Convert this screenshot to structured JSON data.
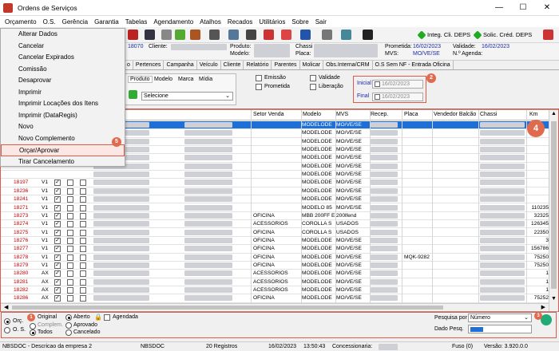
{
  "window": {
    "title": "Ordens de Serviços"
  },
  "menubar": [
    "Orçamento",
    "O.S.",
    "Gerência",
    "Garantia",
    "Tabelas",
    "Agendamento",
    "Atalhos",
    "Recados",
    "Utilitários",
    "Sobre",
    "Sair"
  ],
  "toolbar": {
    "integ": "Integ. Cli. DEPS",
    "solic": "Solic. Créd. DEPS"
  },
  "dropdown": [
    "Alterar Dados",
    "Cancelar",
    "Cancelar Expirados",
    "Comissão",
    "Desaprovar",
    "Imprimir",
    "Imprimir Locações dos Itens",
    "Imprimir (DataRegis)",
    "Novo",
    "Novo Complemento",
    "Orçar/Aprovar",
    "Tirar Cancelamento"
  ],
  "info": {
    "num": "18070",
    "cliente_lbl": "Cliente:",
    "produto_lbl": "Produto:",
    "modelo_lbl": "Modelo:",
    "chassi_lbl": "Chassi",
    "placa_lbl": "Placa:",
    "prometida_lbl": "Prometida:",
    "prometida": "16/02/2023",
    "mvs_lbl": "MVS:",
    "mvs": "MO/VE/SE",
    "validade_lbl": "Validade:",
    "validade": "16/02/2023",
    "agenda_lbl": "N.º Agenda:"
  },
  "tabs": [
    "o",
    "Pertences",
    "Campanha",
    "Veículo",
    "Cliente",
    "Relatório",
    "Parentes",
    "Molicar",
    "Obs.Interna/CRM",
    "O.S Sem NF - Entrada Oficina"
  ],
  "filter": {
    "subtabs": [
      "Produto",
      "Modelo",
      "Marca",
      "Mídia"
    ],
    "select": "Selecione",
    "checks": [
      "Emissão",
      "Prometida",
      "Validade",
      "Liberação"
    ],
    "inicial_lbl": "Inicial",
    "final_lbl": "Final",
    "inicial": "16/02/2023",
    "final": "16/02/2023"
  },
  "grid": {
    "headers": [
      "Setor Venda",
      "Modelo",
      "MVS",
      "Recep.",
      "Placa",
      "Vendedor Balcão",
      "Chassi",
      "Km"
    ],
    "rows": [
      {
        "code": "",
        "t": "",
        "setor": "",
        "modelo": "MODELODE",
        "mvs": "MO/VE/SE",
        "placa": "",
        "km": ""
      },
      {
        "code": "",
        "t": "",
        "setor": "",
        "modelo": "MODELODE",
        "mvs": "MO/VE/SE",
        "placa": "",
        "km": ""
      },
      {
        "code": "",
        "t": "",
        "setor": "",
        "modelo": "MODELODE",
        "mvs": "MO/VE/SE",
        "placa": "",
        "km": ""
      },
      {
        "code": "",
        "t": "",
        "setor": "",
        "modelo": "MODELODE",
        "mvs": "MO/VE/SE",
        "placa": "",
        "km": ""
      },
      {
        "code": "",
        "t": "",
        "setor": "",
        "modelo": "MODELODE",
        "mvs": "MO/VE/SE",
        "placa": "",
        "km": ""
      },
      {
        "code": "",
        "t": "",
        "setor": "",
        "modelo": "MODELODE",
        "mvs": "MO/VE/SE",
        "placa": "",
        "km": ""
      },
      {
        "code": "",
        "t": "",
        "setor": "",
        "modelo": "MODELODE",
        "mvs": "MO/VE/SE",
        "placa": "",
        "km": ""
      },
      {
        "code": "18197",
        "t": "V1",
        "setor": "",
        "modelo": "MODELODE",
        "mvs": "MO/VE/SE",
        "placa": "",
        "km": ""
      },
      {
        "code": "18236",
        "t": "V1",
        "setor": "",
        "modelo": "MODELODE",
        "mvs": "MO/VE/SE",
        "placa": "",
        "km": ""
      },
      {
        "code": "18241",
        "t": "V1",
        "setor": "",
        "modelo": "MODELODE",
        "mvs": "MO/VE/SE",
        "placa": "",
        "km": ""
      },
      {
        "code": "18271",
        "t": "V1",
        "setor": "",
        "modelo": "MODELO 85",
        "mvs": "MO/VE/SE",
        "placa": "",
        "km": "110235"
      },
      {
        "code": "18273",
        "t": "V1",
        "setor": "OFICINA",
        "modelo": "MBB 200FF E",
        "mvs": "200lfend",
        "placa": "",
        "km": "32325"
      },
      {
        "code": "18274",
        "t": "V1",
        "setor": "ACESSORIOS",
        "modelo": "COROLLA S",
        "mvs": "USADOS",
        "placa": "",
        "km": "126345"
      },
      {
        "code": "18275",
        "t": "V1",
        "setor": "OFICINA",
        "modelo": "COROLLA S",
        "mvs": "USADOS",
        "placa": "",
        "km": "22350"
      },
      {
        "code": "18276",
        "t": "V1",
        "setor": "OFICINA",
        "modelo": "MODELODE",
        "mvs": "MO/VE/SE",
        "placa": "",
        "km": "3"
      },
      {
        "code": "18277",
        "t": "V1",
        "setor": "OFICINA",
        "modelo": "MODELODE",
        "mvs": "MO/VE/SE",
        "placa": "",
        "km": "156786"
      },
      {
        "code": "18278",
        "t": "V1",
        "setor": "OFICINA",
        "modelo": "MODELODE",
        "mvs": "MO/VE/SE",
        "placa": "MQK-9282",
        "km": "75250"
      },
      {
        "code": "18279",
        "t": "V1",
        "setor": "OFICINA",
        "modelo": "MODELODE",
        "mvs": "MO/VE/SE",
        "placa": "",
        "km": "75250"
      },
      {
        "code": "18280",
        "t": "AX",
        "setor": "ACESSORIOS",
        "modelo": "MODELODE",
        "mvs": "MO/VE/SE",
        "placa": "",
        "km": "1"
      },
      {
        "code": "18281",
        "t": "AX",
        "setor": "ACESSORIOS",
        "modelo": "MODELODE",
        "mvs": "MO/VE/SE",
        "placa": "",
        "km": "1"
      },
      {
        "code": "18282",
        "t": "AX",
        "setor": "ACESSORIOS",
        "modelo": "MODELODE",
        "mvs": "MO/VE/SE",
        "placa": "",
        "km": "1"
      },
      {
        "code": "18286",
        "t": "AX",
        "setor": "OFICINA",
        "modelo": "MODELODE",
        "mvs": "MO/VE/SE",
        "placa": "",
        "km": "75252"
      }
    ]
  },
  "bottom": {
    "orc": "Orç.",
    "os": "O. S.",
    "original": "Original",
    "complem": "Complem.",
    "todos": "Todos",
    "aberto": "Aberto",
    "aprovado": "Aprovado",
    "cancelado": "Cancelado",
    "agendada": "Agendada",
    "pesquisa_lbl": "Pesquisa por",
    "pesquisa_val": "Número",
    "dado_lbl": "Dado Pesq."
  },
  "status": {
    "empresa": "NBSDOC - Descricao da empresa 2",
    "user": "NBSDOC",
    "registros": "20 Registros",
    "data": "16/02/2023",
    "hora": "13:50:43",
    "conc": "Concessionaria:",
    "fuso": "Fuso (0)",
    "versao": "Versão: 3.920.0.0"
  },
  "badges": [
    "1",
    "2",
    "3",
    "4",
    "5"
  ],
  "colors": {
    "accent": "#e06a4e",
    "code": "#cc0000",
    "blue": "#1a2aa8"
  }
}
